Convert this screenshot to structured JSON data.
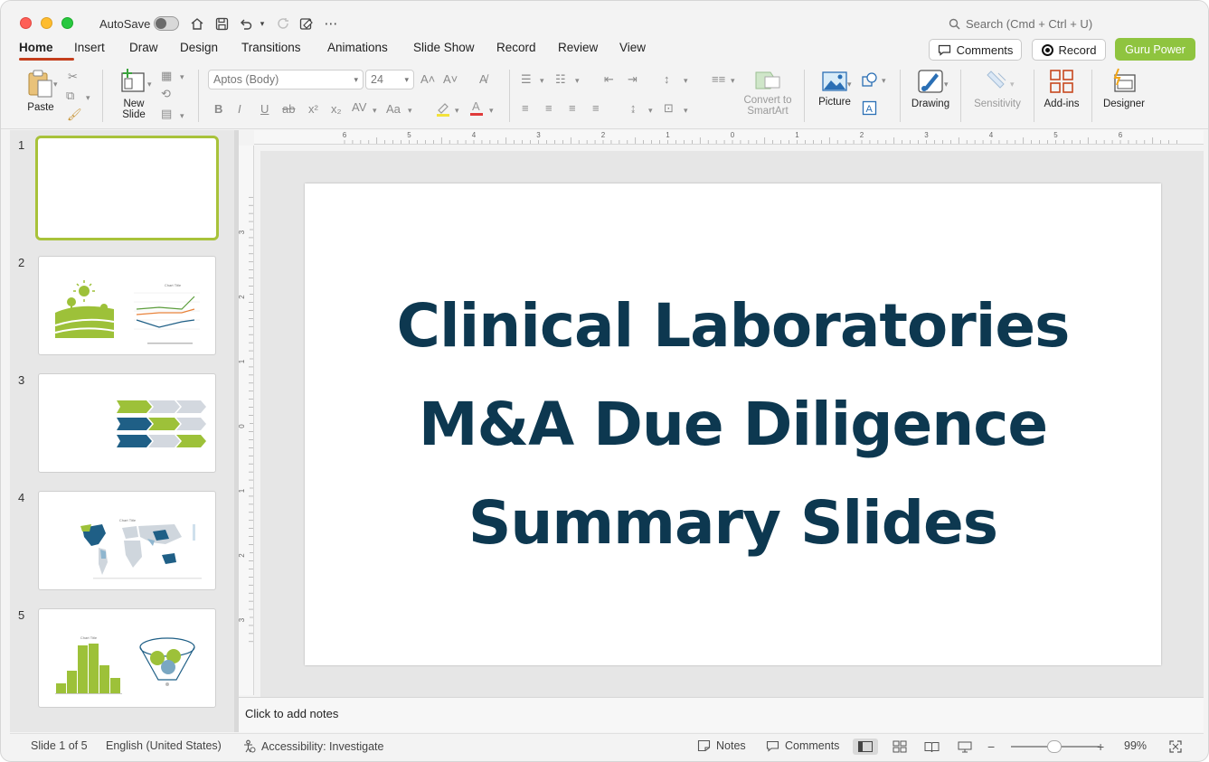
{
  "titlebar": {
    "autosave_label": "AutoSave",
    "search_placeholder": "Search (Cmd + Ctrl + U)"
  },
  "ribbon_tabs": [
    "Home",
    "Insert",
    "Draw",
    "Design",
    "Transitions",
    "Animations",
    "Slide Show",
    "Record",
    "Review",
    "View"
  ],
  "active_tab": "Home",
  "header_buttons": {
    "comments": "Comments",
    "record": "Record",
    "guru": "Guru Power"
  },
  "ribbon": {
    "paste": "Paste",
    "new_slide": "New\nSlide",
    "font_name": "Aptos (Body)",
    "font_size": "24",
    "convert_smartart": "Convert to\nSmartArt",
    "picture": "Picture",
    "drawing": "Drawing",
    "sensitivity": "Sensitivity",
    "addins": "Add-ins",
    "designer": "Designer"
  },
  "slides": [
    {
      "number": "1"
    },
    {
      "number": "2"
    },
    {
      "number": "3"
    },
    {
      "number": "4"
    },
    {
      "number": "5"
    }
  ],
  "thumb_text": {
    "chart_title": "Chart Title"
  },
  "slide": {
    "title": "Clinical Laboratories M&A Due Diligence Summary Slides"
  },
  "notes": {
    "placeholder": "Click to add notes"
  },
  "statusbar": {
    "slide_counter": "Slide 1 of 5",
    "language": "English (United States)",
    "accessibility": "Accessibility: Investigate",
    "notes": "Notes",
    "comments": "Comments",
    "zoom": "99%"
  },
  "ruler": {
    "h_labels": [
      "6",
      "5",
      "4",
      "3",
      "2",
      "1",
      "0",
      "1",
      "2",
      "3",
      "4",
      "5",
      "6"
    ],
    "v_labels": [
      "3",
      "2",
      "1",
      "0",
      "1",
      "2",
      "3"
    ]
  },
  "colors": {
    "accent_tab": "#c43e1c",
    "guru": "#8fc43f",
    "title_text": "#0d3850",
    "selected_slide_border": "#a8c23a"
  }
}
